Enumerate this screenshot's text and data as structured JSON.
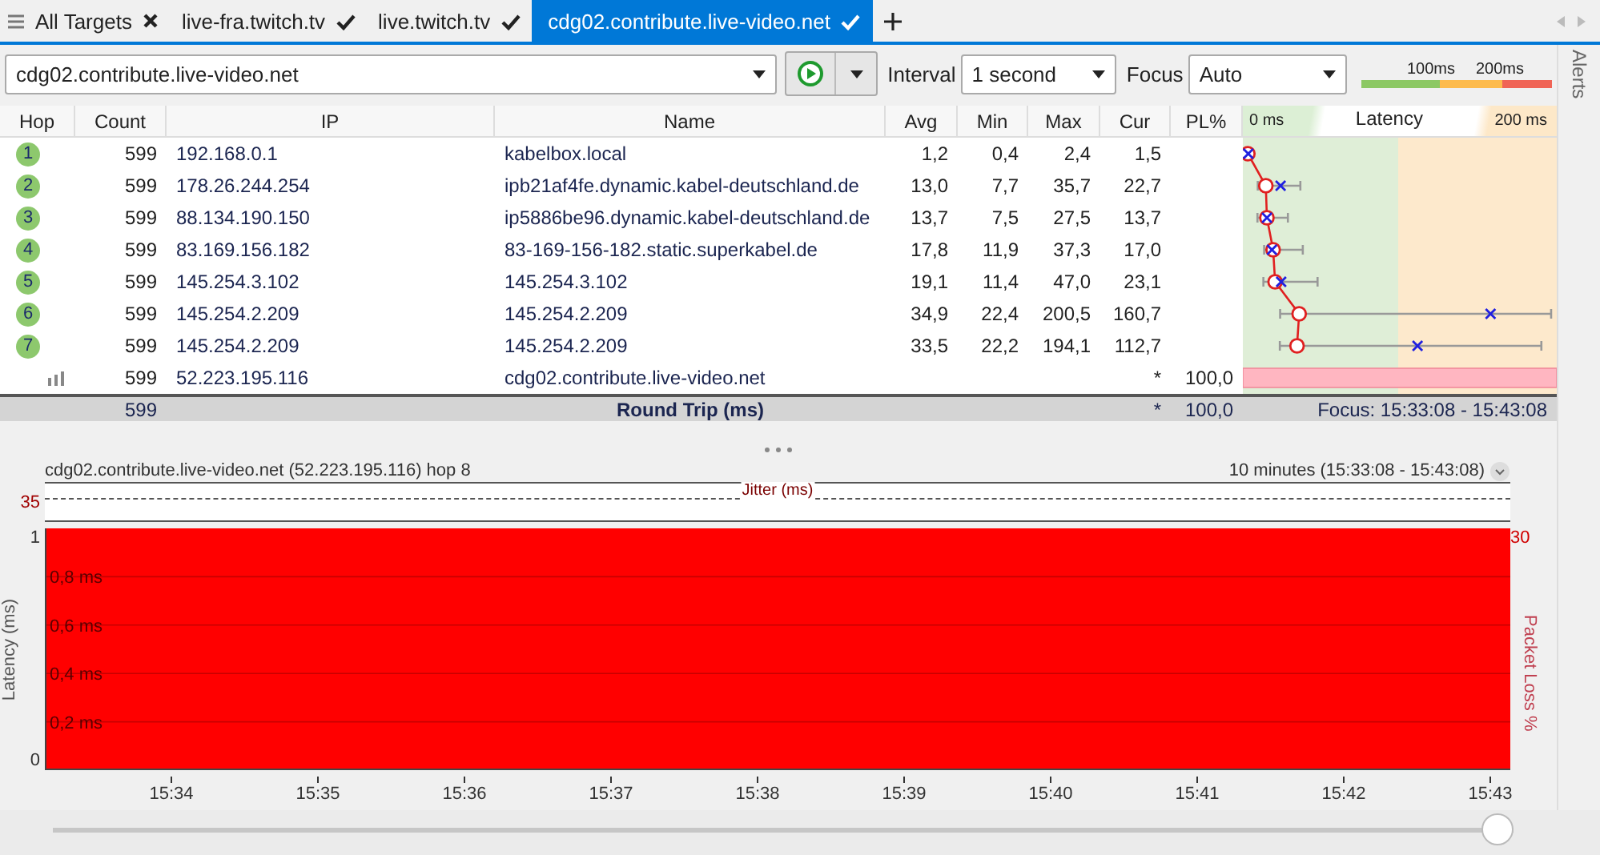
{
  "tabs": [
    {
      "kind": "overview",
      "label": "All Targets",
      "selected": false
    },
    {
      "kind": "target",
      "label": "live-fra.twitch.tv",
      "selected": false
    },
    {
      "kind": "target",
      "label": "live.twitch.tv",
      "selected": false
    },
    {
      "kind": "target",
      "label": "cdg02.contribute.live-video.net",
      "selected": true
    }
  ],
  "toolbar": {
    "target": "cdg02.contribute.live-video.net",
    "interval_label": "Interval",
    "interval": "1 second",
    "focus_label": "Focus",
    "focus": "Auto",
    "legend": [
      "100ms",
      "200ms"
    ]
  },
  "table": {
    "columns": [
      "Hop",
      "Count",
      "IP",
      "Name",
      "Avg",
      "Min",
      "Max",
      "Cur",
      "PL%"
    ],
    "latency_header": {
      "min": "0 ms",
      "title": "Latency",
      "max": "200 ms"
    },
    "rows": [
      {
        "kind": "hop",
        "hop": "1",
        "count": "599",
        "ip": "192.168.0.1",
        "name": "kabelbox.local",
        "avg": "1,2",
        "min": "0,4",
        "max": "2,4",
        "cur": "1,5"
      },
      {
        "kind": "hop",
        "hop": "2",
        "count": "599",
        "ip": "178.26.244.254",
        "name": "ipb21af4fe.dynamic.kabel-deutschland.de",
        "avg": "13,0",
        "min": "7,7",
        "max": "35,7",
        "cur": "22,7"
      },
      {
        "kind": "hop",
        "hop": "3",
        "count": "599",
        "ip": "88.134.190.150",
        "name": "ip5886be96.dynamic.kabel-deutschland.de",
        "avg": "13,7",
        "min": "7,5",
        "max": "27,5",
        "cur": "13,7"
      },
      {
        "kind": "hop",
        "hop": "4",
        "count": "599",
        "ip": "83.169.156.182",
        "name": "83-169-156-182.static.superkabel.de",
        "avg": "17,8",
        "min": "11,9",
        "max": "37,3",
        "cur": "17,0"
      },
      {
        "kind": "hop",
        "hop": "5",
        "count": "599",
        "ip": "145.254.3.102",
        "name": "145.254.3.102",
        "avg": "19,1",
        "min": "11,4",
        "max": "47,0",
        "cur": "23,1"
      },
      {
        "kind": "hop",
        "hop": "6",
        "count": "599",
        "ip": "145.254.2.209",
        "name": "145.254.2.209",
        "avg": "34,9",
        "min": "22,4",
        "max": "200,5",
        "cur": "160,7"
      },
      {
        "kind": "hop",
        "hop": "7",
        "count": "599",
        "ip": "145.254.2.209",
        "name": "145.254.2.209",
        "avg": "33,5",
        "min": "22,2",
        "max": "194,1",
        "cur": "112,7"
      },
      {
        "kind": "destination",
        "count": "599",
        "ip": "52.223.195.116",
        "name": "cdg02.contribute.live-video.net",
        "cur": "*",
        "pl": "100,0"
      }
    ],
    "summary": {
      "count": "599",
      "label": "Round Trip (ms)",
      "cur": "*",
      "pl": "100,0",
      "focus": "Focus: 15:33:08 - 15:43:08"
    }
  },
  "graph": {
    "title": "cdg02.contribute.live-video.net (52.223.195.116) hop 8",
    "range": "10 minutes (15:33:08 - 15:43:08)",
    "jitter_label": "Jitter (ms)",
    "jitter_tick": "35",
    "ylabel": "Latency (ms)",
    "y2label": "Packet Loss %",
    "yticks": [
      "1",
      "0"
    ],
    "inner_ticks": [
      "0,8 ms",
      "0,6 ms",
      "0,4 ms",
      "0,2 ms"
    ],
    "y2tick": "30",
    "xticks": [
      "15:34",
      "15:35",
      "15:36",
      "15:37",
      "15:38",
      "15:39",
      "15:40",
      "15:41",
      "15:42",
      "15:43"
    ]
  },
  "slider": {
    "level": 1
  },
  "sidebar": {
    "label": "Alerts"
  }
}
